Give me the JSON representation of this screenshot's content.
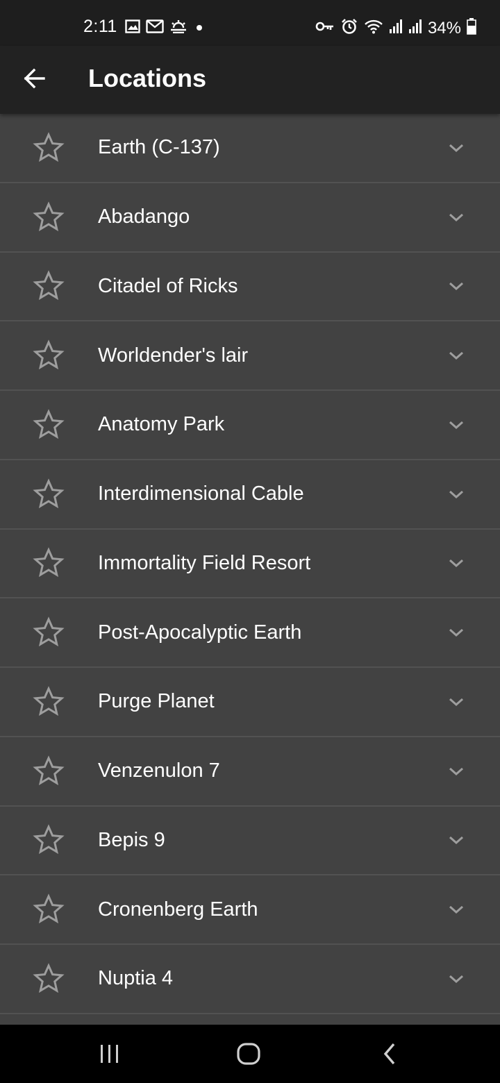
{
  "status_bar": {
    "time": "2:11",
    "battery_percent": "34%",
    "left_icons": [
      "image-icon",
      "gmail-icon",
      "weather-icon",
      "notification-dot-icon"
    ],
    "right_icons": [
      "vpn-key-icon",
      "alarm-icon",
      "wifi-icon",
      "signal-icon",
      "signal-icon",
      "battery-icon"
    ]
  },
  "app_bar": {
    "title": "Locations",
    "back_icon": "arrow-back-icon"
  },
  "locations": [
    {
      "name": "Earth (C-137)"
    },
    {
      "name": "Abadango"
    },
    {
      "name": "Citadel of Ricks"
    },
    {
      "name": "Worldender's lair"
    },
    {
      "name": "Anatomy Park"
    },
    {
      "name": "Interdimensional Cable"
    },
    {
      "name": "Immortality Field Resort"
    },
    {
      "name": "Post-Apocalyptic Earth"
    },
    {
      "name": "Purge Planet"
    },
    {
      "name": "Venzenulon 7"
    },
    {
      "name": "Bepis 9"
    },
    {
      "name": "Cronenberg Earth"
    },
    {
      "name": "Nuptia 4"
    }
  ],
  "row_icons": {
    "leading": "star-outline-icon",
    "trailing": "chevron-down-icon"
  },
  "nav_bar": {
    "icons": [
      "recents-icon",
      "home-icon",
      "back-icon"
    ]
  },
  "colors": {
    "background": "#424242",
    "app_bar": "#222222",
    "status_bar": "#1e1e1e",
    "divider": "#525252",
    "icon_grey": "#9e9e9e"
  }
}
